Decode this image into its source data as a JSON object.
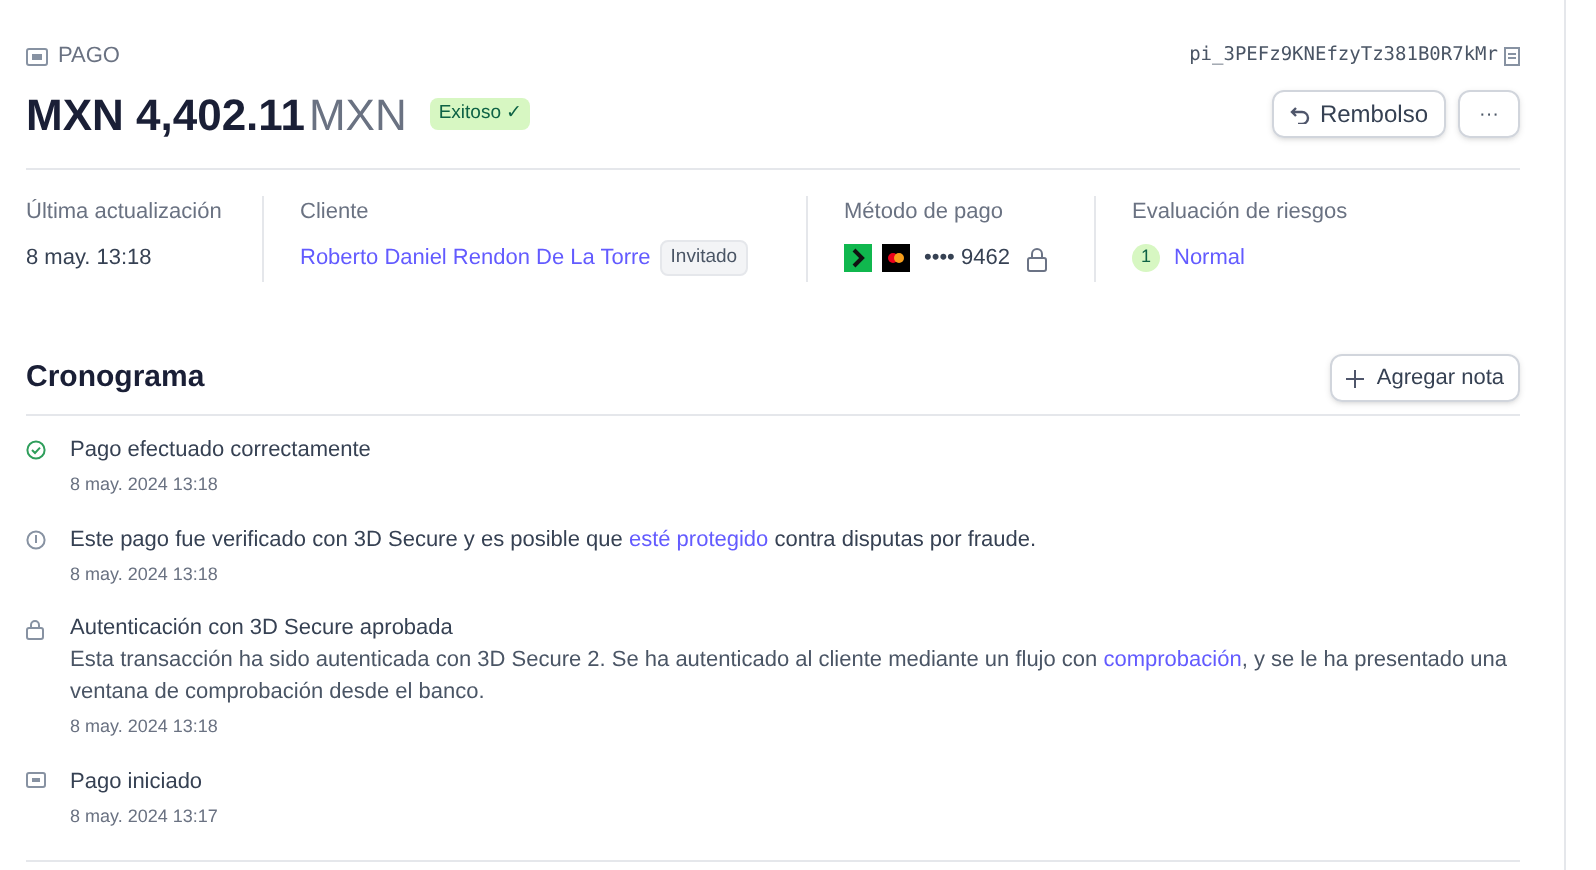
{
  "header": {
    "label": "PAGO",
    "payment_id": "pi_3PEFz9KNEfzyTz381B0R7kMr",
    "amount": "MXN 4,402.11",
    "currency": "MXN",
    "status": "Exitoso ✓",
    "buttons": [
      {
        "kind": "refund",
        "label": "Rembolso"
      },
      {
        "kind": "more",
        "label": "···"
      }
    ]
  },
  "details": [
    {
      "kind": "text",
      "label": "Última actualización",
      "value": "8 may. 13:18"
    },
    {
      "kind": "customer",
      "label": "Cliente",
      "value": "Roberto Daniel Rendon De La Torre",
      "badge": "Invitado"
    },
    {
      "kind": "card",
      "label": "Método de pago",
      "value": "•••• 9462"
    },
    {
      "kind": "risk",
      "label": "Evaluación de riesgos",
      "score": "1",
      "value": "Normal"
    }
  ],
  "timeline": {
    "title": "Cronograma",
    "button": "Agregar nota",
    "events": [
      {
        "kind": "success",
        "title": "Pago efectuado correctamente",
        "time": "8 may. 2024 13:18"
      },
      {
        "kind": "shield",
        "title_parts": [
          {
            "text": "Este pago fue verificado con 3D Secure y es posible que "
          },
          {
            "link": "esté protegido"
          },
          {
            "text": " contra disputas por fraude."
          }
        ],
        "time": "8 may. 2024 13:18"
      },
      {
        "kind": "lock",
        "title": "Autenticación con 3D Secure aprobada",
        "description_parts": [
          {
            "text": "Esta transacción ha sido autenticada con 3D Secure 2. Se ha autenticado al cliente mediante un flujo con "
          },
          {
            "link": "comprobación"
          },
          {
            "text": ", y se le ha presentado una ventana de comprobación desde el banco."
          }
        ],
        "time": "8 may. 2024 13:18"
      },
      {
        "kind": "payment",
        "title": "Pago iniciado",
        "time": "8 may. 2024 13:17"
      }
    ]
  }
}
